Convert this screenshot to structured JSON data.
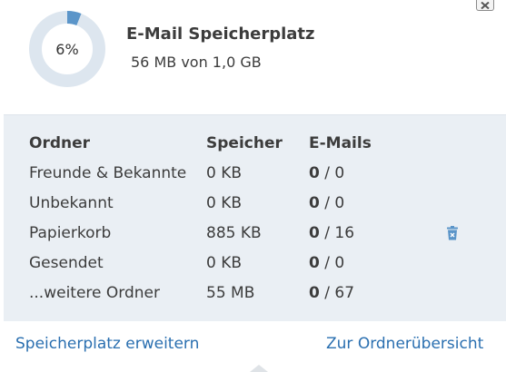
{
  "colors": {
    "accent": "#2a6fb0",
    "donut_track": "#dde6ef",
    "donut_fill": "#5b95c9",
    "table_bg": "#eaeff4"
  },
  "usage": {
    "percent": 6,
    "percent_label": "6%",
    "title": "E-Mail Speicherplatz",
    "summary": "56 MB von 1,0 GB"
  },
  "table": {
    "headers": {
      "folder": "Ordner",
      "storage": "Speicher",
      "emails": "E-Mails"
    },
    "rows": [
      {
        "folder": "Freunde & Bekannte",
        "storage": "0 KB",
        "unread": "0",
        "total": " / 0"
      },
      {
        "folder": "Unbekannt",
        "storage": "0 KB",
        "unread": "0",
        "total": " / 0"
      },
      {
        "folder": "Papierkorb",
        "storage": "885 KB",
        "unread": "0",
        "total": " / 16",
        "icon": "trash-icon"
      },
      {
        "folder": "Gesendet",
        "storage": "0 KB",
        "unread": "0",
        "total": " / 0"
      },
      {
        "folder": "...weitere Ordner",
        "storage": "55 MB",
        "unread": "0",
        "total": " / 67"
      }
    ]
  },
  "footer": {
    "expand_link": "Speicherplatz erweitern",
    "overview_link": "Zur Ordnerübersicht"
  },
  "icons": {
    "close": "close-icon",
    "trash": "trash-icon"
  }
}
